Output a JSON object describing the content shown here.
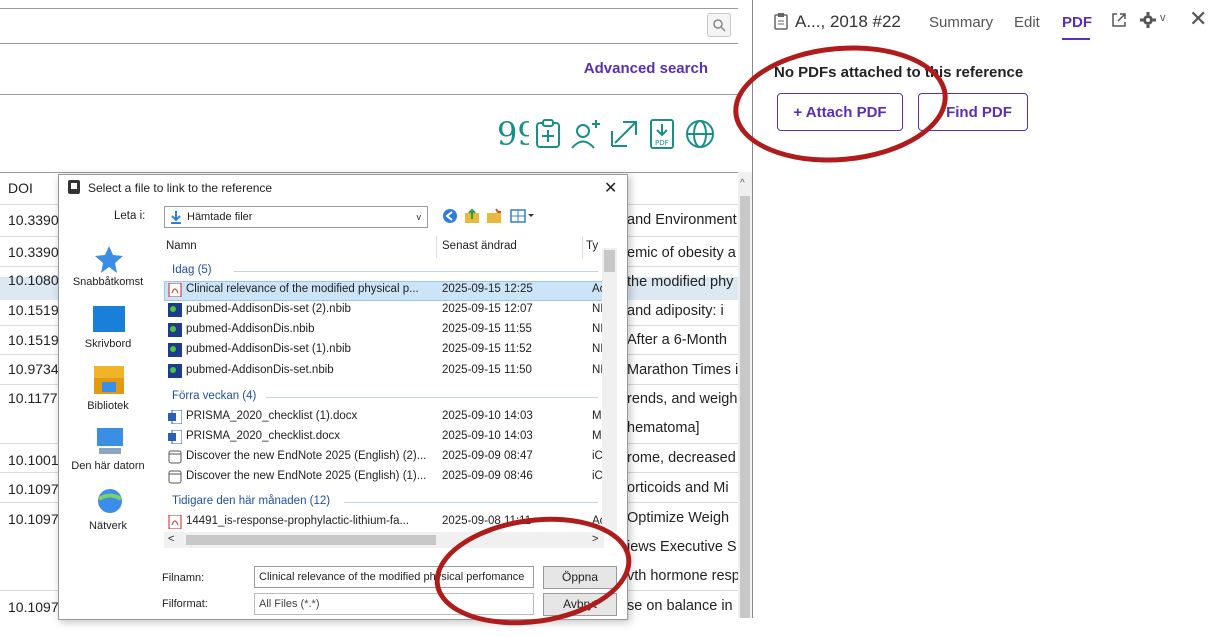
{
  "left_panel": {
    "advanced_search": "Advanced search",
    "toolbar_icons": [
      "quote-icon",
      "clipboard-add-icon",
      "add-user-icon",
      "share-arrow-icon",
      "pdf-download-icon",
      "globe-icon"
    ],
    "table": {
      "col_doi": "DOI",
      "rows": [
        {
          "doi": "10.3390",
          "title": "and Environment"
        },
        {
          "doi": "10.3390",
          "title": "emic of obesity a"
        },
        {
          "doi": "10.1080",
          "title": "the modified phy"
        },
        {
          "doi": "10.1519",
          "title": "and adiposity: i"
        },
        {
          "doi": "10.1519",
          "title": "After a 6-Month"
        },
        {
          "doi": "10.9734",
          "title": "Marathon Times i"
        },
        {
          "doi": "10.1177",
          "title": "rends, and weigh"
        },
        {
          "doi": "",
          "title": "hematoma]"
        },
        {
          "doi": "10.1001",
          "title": "rome, decreased"
        },
        {
          "doi": "10.1097",
          "title": "orticoids and Mi"
        },
        {
          "doi": "10.1097",
          "title": "Optimize Weigh"
        },
        {
          "doi": "",
          "title": "iews Executive S"
        },
        {
          "doi": "",
          "title": "vth hormone resp"
        },
        {
          "doi": "10.1097",
          "title": "se on balance in"
        }
      ]
    }
  },
  "right_panel": {
    "reference": "A..., 2018 #22",
    "tabs": {
      "summary": "Summary",
      "edit": "Edit",
      "pdf": "PDF"
    },
    "no_pdf_text": "No PDFs attached to this reference",
    "attach_pdf": "+ Attach PDF",
    "find_pdf": "Find PDF"
  },
  "dialog": {
    "title": "Select a file to link to the reference",
    "look_in_label": "Leta i:",
    "look_in_value": "Hämtade filer",
    "columns": {
      "name": "Namn",
      "modified": "Senast ändrad",
      "type": "Ty"
    },
    "places": [
      "Snabbåtkomst",
      "Skrivbord",
      "Bibliotek",
      "Den här datorn",
      "Nätverk"
    ],
    "groups": {
      "today": "Idag (5)",
      "last_week": "Förra veckan (4)",
      "this_month": "Tidigare den här månaden (12)"
    },
    "files": [
      {
        "name": "Clinical relevance of the modified physical p...",
        "date": "2025-09-15 12:25",
        "type": "Ac"
      },
      {
        "name": "pubmed-AddisonDis-set (2).nbib",
        "date": "2025-09-15 12:07",
        "type": "NI"
      },
      {
        "name": "pubmed-AddisonDis.nbib",
        "date": "2025-09-15 11:55",
        "type": "NI"
      },
      {
        "name": "pubmed-AddisonDis-set (1).nbib",
        "date": "2025-09-15 11:52",
        "type": "NI"
      },
      {
        "name": "pubmed-AddisonDis-set.nbib",
        "date": "2025-09-15 11:50",
        "type": "NI"
      },
      {
        "name": "PRISMA_2020_checklist (1).docx",
        "date": "2025-09-10 14:03",
        "type": "M"
      },
      {
        "name": "PRISMA_2020_checklist.docx",
        "date": "2025-09-10 14:03",
        "type": "M"
      },
      {
        "name": "Discover the new EndNote 2025 (English) (2)...",
        "date": "2025-09-09 08:47",
        "type": "iC"
      },
      {
        "name": "Discover the new EndNote 2025 (English) (1)...",
        "date": "2025-09-09 08:46",
        "type": "iC"
      },
      {
        "name": "14491_is-response-prophylactic-lithium-fa...",
        "date": "2025-09-08 11:11",
        "type": "Ac"
      }
    ],
    "filename_label": "Filnamn:",
    "filename_value": "Clinical relevance of the modified physical perfomance",
    "open_button": "Öppna",
    "filetype_label": "Filformat:",
    "filetype_value": "All Files (*.*)",
    "cancel_button": "Avbryt"
  },
  "colors": {
    "accent": "#5a2fb5",
    "annotation": "#b01c1c",
    "selection": "#cce4f7"
  }
}
